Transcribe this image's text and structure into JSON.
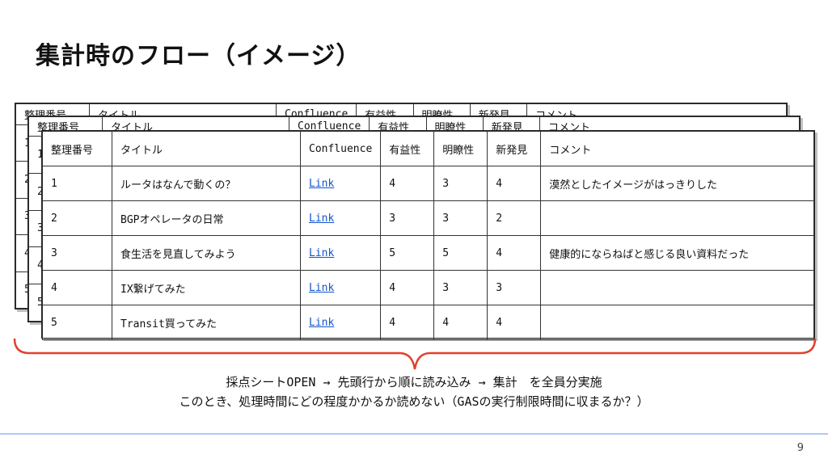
{
  "slide": {
    "title": "集計時のフロー（イメージ）",
    "page_number": "9"
  },
  "table": {
    "headers": [
      "整理番号",
      "タイトル",
      "Confluence",
      "有益性",
      "明瞭性",
      "新発見",
      "コメント"
    ],
    "rows": [
      [
        "1",
        "ルータはなんで動くの？",
        "Link",
        "4",
        "3",
        "4",
        "漠然としたイメージがはっきりした"
      ],
      [
        "2",
        "BGPオペレータの日常",
        "Link",
        "3",
        "3",
        "2",
        ""
      ],
      [
        "3",
        "食生活を見直してみよう",
        "Link",
        "5",
        "5",
        "4",
        "健康的にならねばと感じる良い資料だった"
      ],
      [
        "4",
        "IX繋げてみた",
        "Link",
        "4",
        "3",
        "3",
        ""
      ],
      [
        "5",
        "Transit買ってみた",
        "Link",
        "4",
        "4",
        "4",
        ""
      ]
    ]
  },
  "notes": {
    "line1": "採点シートOPEN → 先頭行から順に読み込み → 集計　を全員分実施",
    "line2": "このとき、処理時間にどの程度かかるか読めない（GASの実行制限時間に収まるか？）"
  },
  "colors": {
    "link": "#1155cc",
    "brace": "#e0402e",
    "footer_line": "#aecbf2"
  }
}
